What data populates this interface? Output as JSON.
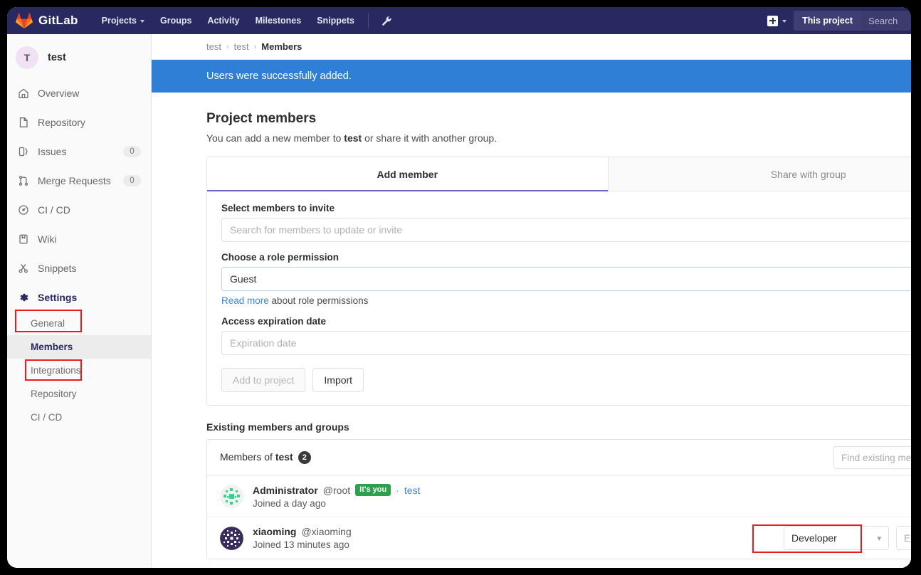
{
  "navbar": {
    "brand": "GitLab",
    "logo_icon": "gitlab-fox-logo",
    "links": [
      {
        "label": "Projects",
        "has_caret": true
      },
      {
        "label": "Groups",
        "has_caret": false
      },
      {
        "label": "Activity",
        "has_caret": false
      },
      {
        "label": "Milestones",
        "has_caret": false
      },
      {
        "label": "Snippets",
        "has_caret": false
      }
    ],
    "wrench_icon": "wrench-icon",
    "plus_icon": "plus-square-icon",
    "plus_caret_icon": "chevron-down-icon",
    "this_project": "This project",
    "search_placeholder": "Search"
  },
  "sidebar": {
    "project_avatar_letter": "T",
    "project_name": "test",
    "items": [
      {
        "label": "Overview",
        "icon": "home-icon",
        "count": null
      },
      {
        "label": "Repository",
        "icon": "document-icon",
        "count": null
      },
      {
        "label": "Issues",
        "icon": "issues-icon",
        "count": "0"
      },
      {
        "label": "Merge Requests",
        "icon": "merge-request-icon",
        "count": "0"
      },
      {
        "label": "CI / CD",
        "icon": "rocket-icon",
        "count": null
      },
      {
        "label": "Wiki",
        "icon": "book-icon",
        "count": null
      },
      {
        "label": "Snippets",
        "icon": "scissors-icon",
        "count": null
      },
      {
        "label": "Settings",
        "icon": "gear-icon",
        "count": null
      }
    ],
    "sub_items": [
      {
        "label": "General",
        "current": false
      },
      {
        "label": "Members",
        "current": true
      },
      {
        "label": "Integrations",
        "current": false
      },
      {
        "label": "Repository",
        "current": false
      },
      {
        "label": "CI / CD",
        "current": false
      }
    ],
    "highlight_color": "#ef1b1b"
  },
  "breadcrumb": {
    "items": [
      "test",
      "test"
    ],
    "current": "Members",
    "separator": "›"
  },
  "alert": {
    "message": "Users were successfully added.",
    "color": "#2f7fd6"
  },
  "main": {
    "title": "Project members",
    "subtitle_before": "You can add a new member to ",
    "subtitle_bold": "test",
    "subtitle_after": " or share it with another group.",
    "tabs": [
      {
        "label": "Add member",
        "active": true
      },
      {
        "label": "Share with group",
        "active": false
      }
    ],
    "form": {
      "members_label": "Select members to invite",
      "members_placeholder": "Search for members to update or invite",
      "role_label": "Choose a role permission",
      "role_value": "Guest",
      "read_more_link": "Read more",
      "read_more_rest": " about role permissions",
      "expiration_label": "Access expiration date",
      "expiration_placeholder": "Expiration date",
      "submit_label": "Add to project",
      "submit_disabled": true,
      "import_label": "Import"
    },
    "existing": {
      "section_title": "Existing members and groups",
      "header_prefix": "Members of ",
      "header_project": "test",
      "count_badge": "2",
      "find_placeholder": "Find existing members by name",
      "search_icon": "search-icon",
      "rows": [
        {
          "name": "Administrator",
          "handle": "@root",
          "badge": "It's you",
          "badge_color": "#2ba14e",
          "dot": "·",
          "source": "test",
          "joined": "Joined a day ago",
          "avatar_icon": "identicon-green",
          "role": null,
          "expires_placeholder": null
        },
        {
          "name": "xiaoming",
          "handle": "@xiaoming",
          "badge": null,
          "badge_color": null,
          "dot": null,
          "source": null,
          "joined": "Joined 13 minutes ago",
          "avatar_icon": "identicon-purple",
          "role": "Developer",
          "role_caret_icon": "chevron-down-icon",
          "expires_placeholder": "Expiration date"
        }
      ]
    }
  }
}
